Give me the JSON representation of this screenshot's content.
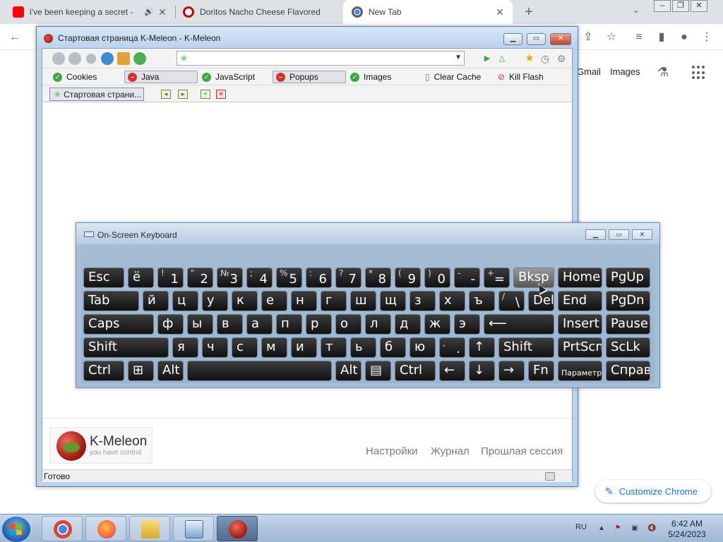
{
  "chrome": {
    "tabs": [
      {
        "title": "i've been keeping a secret - ",
        "icon": "youtube-icon",
        "color": "#ff0000"
      },
      {
        "title": "Doritos Nacho Cheese Flavored T",
        "icon": "target-icon",
        "color": "#cc0000"
      },
      {
        "title": "New Tab",
        "icon": "chrome-icon",
        "color": "#5f6368"
      }
    ],
    "new_tab": "+",
    "ntp": {
      "gmail": "Gmail",
      "images": "Images"
    },
    "customize": "Customize Chrome"
  },
  "kmeleon": {
    "title": "Стартовая страница K-Meleon - K-Meleon",
    "plugins": [
      {
        "label": "Cookies",
        "state": "on"
      },
      {
        "label": "Java",
        "state": "off"
      },
      {
        "label": "JavaScript",
        "state": "on"
      },
      {
        "label": "Popups",
        "state": "off"
      },
      {
        "label": "Images",
        "state": "on"
      },
      {
        "label": "Clear Cache",
        "state": "action"
      },
      {
        "label": "Kill Flash",
        "state": "action"
      }
    ],
    "tab_title": "Стартовая страни...",
    "logo_brand": "K-Meleon",
    "logo_tagline": "you have control",
    "links": [
      "Настройки",
      "Журнал",
      "Прошлая сессия"
    ],
    "status": "Готово"
  },
  "osk": {
    "title": "On-Screen Keyboard",
    "rows": [
      [
        {
          "main": "Esc"
        },
        {
          "main": "ё"
        },
        {
          "top": "!",
          "bottom": "1"
        },
        {
          "top": "\"",
          "bottom": "2"
        },
        {
          "top": "№",
          "bottom": "3"
        },
        {
          "top": ";",
          "bottom": "4"
        },
        {
          "top": "%",
          "bottom": "5"
        },
        {
          "top": ":",
          "bottom": "6"
        },
        {
          "top": "?",
          "bottom": "7"
        },
        {
          "top": "*",
          "bottom": "8"
        },
        {
          "top": "(",
          "bottom": "9"
        },
        {
          "top": ")",
          "bottom": "0"
        },
        {
          "top": "-",
          "bottom": "-"
        },
        {
          "top": "+",
          "bottom": "="
        },
        {
          "main": "Bksp"
        },
        {
          "main": "Home"
        },
        {
          "main": "PgUp"
        }
      ],
      [
        {
          "main": "Tab"
        },
        {
          "main": "й"
        },
        {
          "main": "ц"
        },
        {
          "main": "у"
        },
        {
          "main": "к"
        },
        {
          "main": "е"
        },
        {
          "main": "н"
        },
        {
          "main": "г"
        },
        {
          "main": "ш"
        },
        {
          "main": "щ"
        },
        {
          "main": "з"
        },
        {
          "main": "х"
        },
        {
          "main": "ъ"
        },
        {
          "top": "/",
          "bottom": "\\"
        },
        {
          "main": "Del"
        },
        {
          "main": "End"
        },
        {
          "main": "PgDn"
        }
      ],
      [
        {
          "main": "Caps"
        },
        {
          "main": "ф"
        },
        {
          "main": "ы"
        },
        {
          "main": "в"
        },
        {
          "main": "а"
        },
        {
          "main": "п"
        },
        {
          "main": "р"
        },
        {
          "main": "о"
        },
        {
          "main": "л"
        },
        {
          "main": "д"
        },
        {
          "main": "ж"
        },
        {
          "main": "э"
        },
        {
          "main": "⟵"
        },
        {
          "main": "Insert"
        },
        {
          "main": "Pause"
        }
      ],
      [
        {
          "main": "Shift"
        },
        {
          "main": "я"
        },
        {
          "main": "ч"
        },
        {
          "main": "с"
        },
        {
          "main": "м"
        },
        {
          "main": "и"
        },
        {
          "main": "т"
        },
        {
          "main": "ь"
        },
        {
          "main": "б"
        },
        {
          "main": "ю"
        },
        {
          "top": ",",
          "bottom": "."
        },
        {
          "main": "↑"
        },
        {
          "main": "Shift"
        },
        {
          "main": "PrtScn"
        },
        {
          "main": "ScLk"
        }
      ],
      [
        {
          "main": "Ctrl"
        },
        {
          "main": "⊞"
        },
        {
          "main": "Alt"
        },
        {
          "main": ""
        },
        {
          "main": "Alt"
        },
        {
          "main": "▤"
        },
        {
          "main": "Ctrl"
        },
        {
          "main": "←"
        },
        {
          "main": "↓"
        },
        {
          "main": "→"
        },
        {
          "main": "Fn"
        },
        {
          "main": "Параметры"
        },
        {
          "main": "Справка"
        }
      ]
    ]
  },
  "taskbar": {
    "language": "RU",
    "time": "6:42 AM",
    "date": "5/24/2023",
    "apps": [
      {
        "name": "chrome",
        "color": "#4285f4"
      },
      {
        "name": "firefox",
        "color": "#ff7139"
      },
      {
        "name": "explorer",
        "color": "#f2c94c"
      },
      {
        "name": "osk",
        "color": "#3a6ea5"
      },
      {
        "name": "kmeleon",
        "color": "#c0392b"
      }
    ]
  }
}
